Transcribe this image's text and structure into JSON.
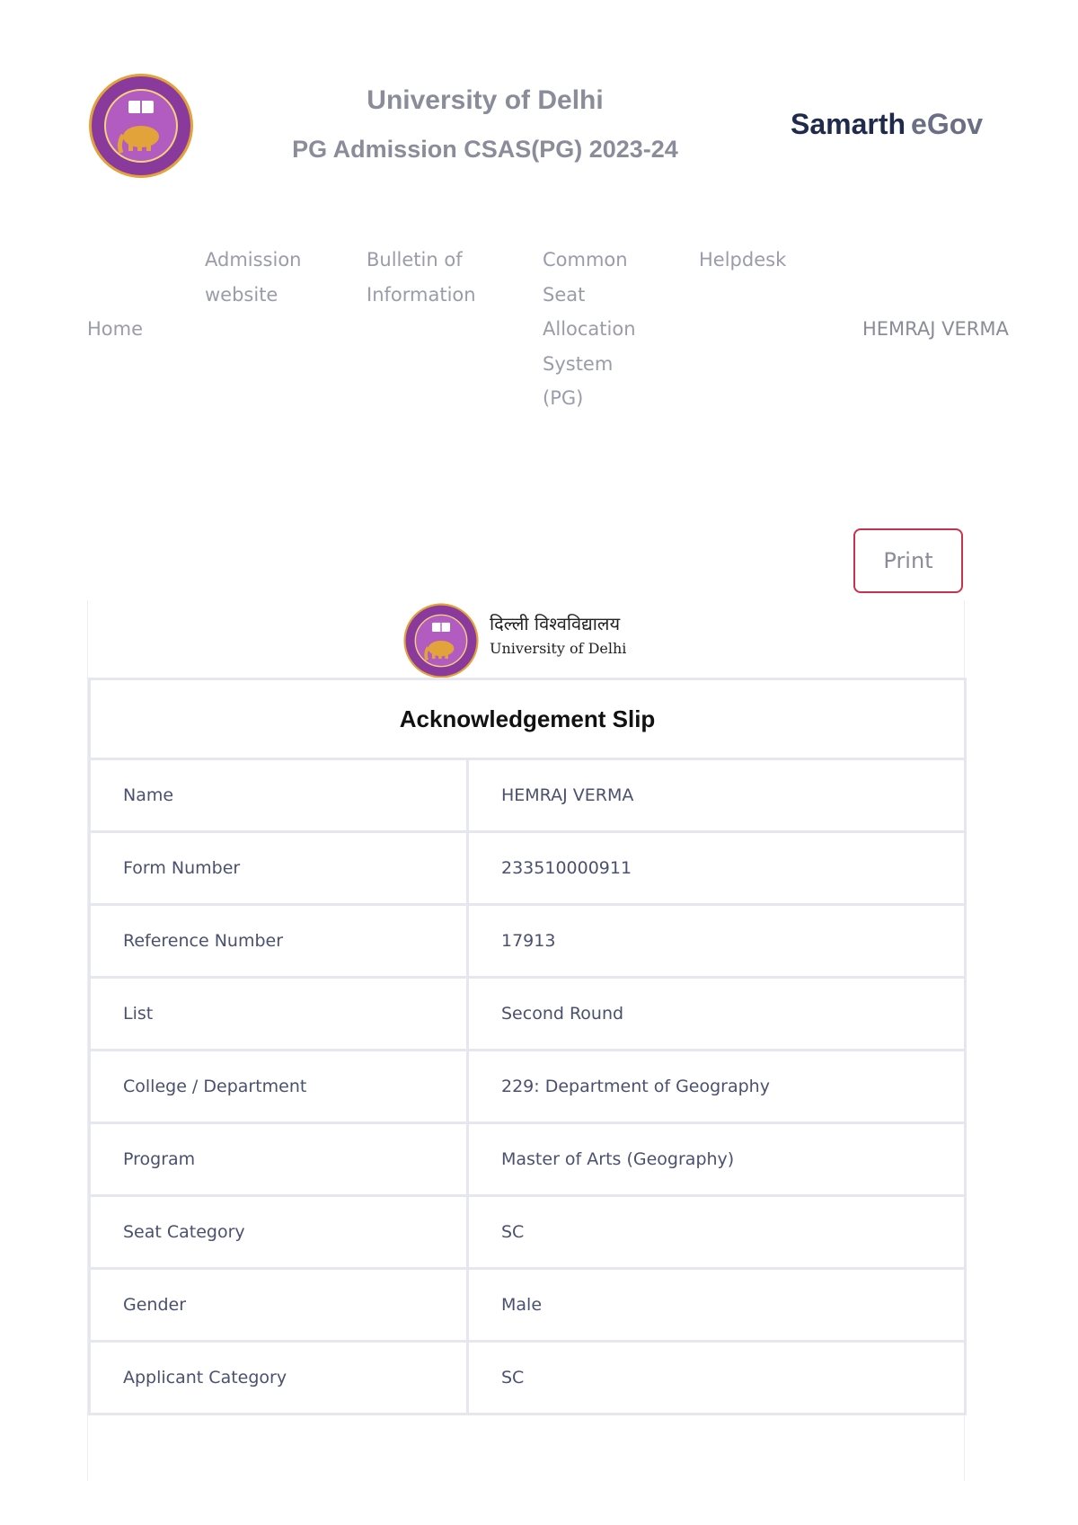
{
  "header": {
    "university": "University of Delhi",
    "admission": "PG Admission CSAS(PG) 2023-24",
    "brand_part1": "Samarth",
    "brand_part2": "eGov"
  },
  "nav": {
    "home": "Home",
    "admission_website": "Admission website",
    "bulletin": "Bulletin of Information",
    "csas": "Common Seat Allocation System (PG)",
    "helpdesk": "Helpdesk",
    "user": "HEMRAJ VERMA"
  },
  "actions": {
    "print": "Print"
  },
  "slip": {
    "hindi_name": "दिल्ली विश्वविद्यालय",
    "english_name": "University of Delhi",
    "title": "Acknowledgement Slip",
    "rows": [
      {
        "label": "Name",
        "value": "HEMRAJ VERMA"
      },
      {
        "label": "Form Number",
        "value": "233510000911"
      },
      {
        "label": "Reference Number",
        "value": "17913"
      },
      {
        "label": "List",
        "value": "Second Round"
      },
      {
        "label": "College / Department",
        "value": "229: Department of Geography"
      },
      {
        "label": "Program",
        "value": "Master of Arts (Geography)"
      },
      {
        "label": "Seat Category",
        "value": "SC"
      },
      {
        "label": "Gender",
        "value": "Male"
      },
      {
        "label": "Applicant Category",
        "value": "SC"
      }
    ]
  },
  "colors": {
    "logo_purple": "#7b2f8e",
    "logo_gold": "#e2a33a",
    "print_border": "#c8324f",
    "brand_dark": "#1f2a4d"
  }
}
